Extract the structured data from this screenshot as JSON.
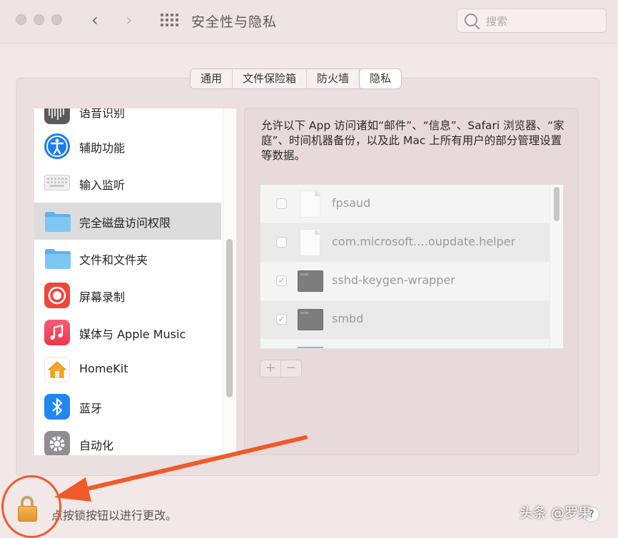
{
  "window": {
    "title": "安全性与隐私"
  },
  "search": {
    "placeholder": "搜索"
  },
  "tabs": [
    {
      "label": "通用",
      "active": false
    },
    {
      "label": "文件保险箱",
      "active": false
    },
    {
      "label": "防火墙",
      "active": false
    },
    {
      "label": "隐私",
      "active": true
    }
  ],
  "sidebar": {
    "items": [
      {
        "label": "语音识别",
        "icon": "waveform-icon"
      },
      {
        "label": "辅助功能",
        "icon": "accessibility-icon"
      },
      {
        "label": "输入监听",
        "icon": "keyboard-icon"
      },
      {
        "label": "完全磁盘访问权限",
        "icon": "folder-icon",
        "selected": true
      },
      {
        "label": "文件和文件夹",
        "icon": "folder-icon"
      },
      {
        "label": "屏幕录制",
        "icon": "screen-record-icon"
      },
      {
        "label": "媒体与 Apple Music",
        "icon": "music-icon"
      },
      {
        "label": "HomeKit",
        "icon": "home-icon"
      },
      {
        "label": "蓝牙",
        "icon": "bluetooth-icon"
      },
      {
        "label": "自动化",
        "icon": "gear-icon"
      }
    ]
  },
  "main": {
    "description": "允许以下 App 访问诸如“邮件”、“信息”、Safari 浏览器、“家庭”、时间机器备份，以及此 Mac 上所有用户的部分管理设置等数据。",
    "apps": [
      {
        "name": "fpsaud",
        "checked": false,
        "icon": "document-icon"
      },
      {
        "name": "com.microsoft.…oupdate.helper",
        "checked": false,
        "icon": "document-icon"
      },
      {
        "name": "sshd-keygen-wrapper",
        "checked": true,
        "icon": "terminal-icon"
      },
      {
        "name": "smbd",
        "checked": true,
        "icon": "terminal-icon"
      }
    ],
    "terminal_icon_text": "exec",
    "add_label": "+",
    "remove_label": "−"
  },
  "footer": {
    "lock_text": "点按锁按钮以进行更改。",
    "help_label": "?"
  },
  "watermark": "头条 @罗果",
  "colors": {
    "annotation_red": "#f05a2a",
    "lock_orange": "#e3932b",
    "selected_row": "#dcdcdc"
  }
}
